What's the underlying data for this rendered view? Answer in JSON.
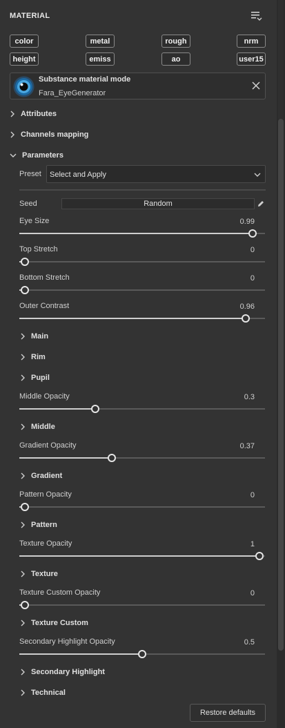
{
  "header": {
    "title": "MATERIAL",
    "menu_icon": "list-settings-icon"
  },
  "channels": {
    "color": "color",
    "metal": "metal",
    "rough": "rough",
    "nrm": "nrm",
    "height": "height",
    "emiss": "emiss",
    "ao": "ao",
    "user15": "user15"
  },
  "material_mode": {
    "title": "Substance material mode",
    "material_name": "Fara_EyeGenerator",
    "close_icon": "close-icon"
  },
  "sections": {
    "attributes": "Attributes",
    "channels_mapping": "Channels mapping",
    "parameters": "Parameters"
  },
  "preset": {
    "label": "Preset",
    "value": "Select and Apply"
  },
  "seed": {
    "label": "Seed",
    "button": "Random"
  },
  "sliders": {
    "eye_size": {
      "label": "Eye Size",
      "value": "0.99",
      "fraction": 0.97
    },
    "top_stretch": {
      "label": "Top Stretch",
      "value": "0",
      "fraction": 0.0
    },
    "bottom_stretch": {
      "label": "Bottom Stretch",
      "value": "0",
      "fraction": 0.0
    },
    "outer_contrast": {
      "label": "Outer Contrast",
      "value": "0.96",
      "fraction": 0.94
    },
    "middle_opacity": {
      "label": "Middle Opacity",
      "value": "0.3",
      "fraction": 0.3
    },
    "gradient_opacity": {
      "label": "Gradient Opacity",
      "value": "0.37",
      "fraction": 0.37
    },
    "pattern_opacity": {
      "label": "Pattern Opacity",
      "value": "0",
      "fraction": 0.0
    },
    "texture_opacity": {
      "label": "Texture Opacity",
      "value": "1",
      "fraction": 1.0
    },
    "texture_custom_opacity": {
      "label": "Texture Custom Opacity",
      "value": "0",
      "fraction": 0.0
    },
    "secondary_highlight_opacity": {
      "label": "Secondary Highlight Opacity",
      "value": "0.5",
      "fraction": 0.5
    }
  },
  "groups": {
    "main": "Main",
    "rim": "Rim",
    "pupil": "Pupil",
    "middle": "Middle",
    "gradient": "Gradient",
    "pattern": "Pattern",
    "texture": "Texture",
    "texture_custom": "Texture Custom",
    "secondary_highlight": "Secondary Highlight",
    "technical": "Technical"
  },
  "footer": {
    "restore_label": "Restore defaults"
  }
}
